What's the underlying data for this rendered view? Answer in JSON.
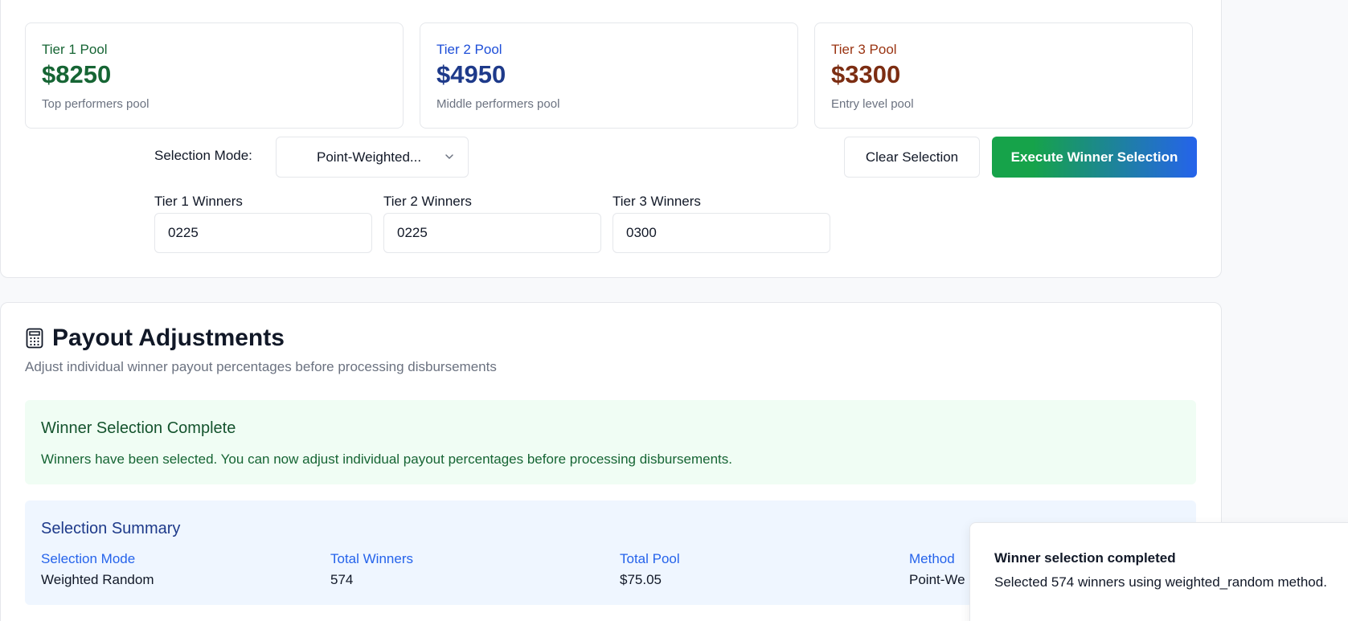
{
  "pools": [
    {
      "title": "Tier 1 Pool",
      "amount": "$8250",
      "subtitle": "Top performers pool",
      "color": "#166534"
    },
    {
      "title": "Tier 2 Pool",
      "amount": "$4950",
      "subtitle": "Middle performers pool",
      "color": "#1e3a8a"
    },
    {
      "title": "Tier 3 Pool",
      "amount": "$3300",
      "subtitle": "Entry level pool",
      "color": "#7c2d12"
    }
  ],
  "controls": {
    "selection_mode_label": "Selection Mode:",
    "selection_mode_value": "Point-Weighted...",
    "clear_label": "Clear Selection",
    "execute_label": "Execute Winner Selection",
    "tier_winners": [
      {
        "label": "Tier 1 Winners",
        "value": "0225"
      },
      {
        "label": "Tier 2 Winners",
        "value": "0225"
      },
      {
        "label": "Tier 3 Winners",
        "value": "0300"
      }
    ]
  },
  "payout": {
    "title": "Payout Adjustments",
    "subtitle": "Adjust individual winner payout percentages before processing disbursements",
    "icon": "calculator-icon"
  },
  "complete": {
    "title": "Winner Selection Complete",
    "description": "Winners have been selected. You can now adjust individual payout percentages before processing disbursements."
  },
  "summary": {
    "title": "Selection Summary",
    "items": [
      {
        "key": "Selection Mode",
        "value": "Weighted Random"
      },
      {
        "key": "Total Winners",
        "value": "574"
      },
      {
        "key": "Total Pool",
        "value": "$75.05"
      },
      {
        "key": "Method",
        "value": "Point-We"
      }
    ]
  },
  "toast": {
    "title": "Winner selection completed",
    "description": "Selected 574 winners using weighted_random method."
  },
  "colors": {
    "accent_green": "#16a34a",
    "accent_blue": "#2563eb"
  }
}
